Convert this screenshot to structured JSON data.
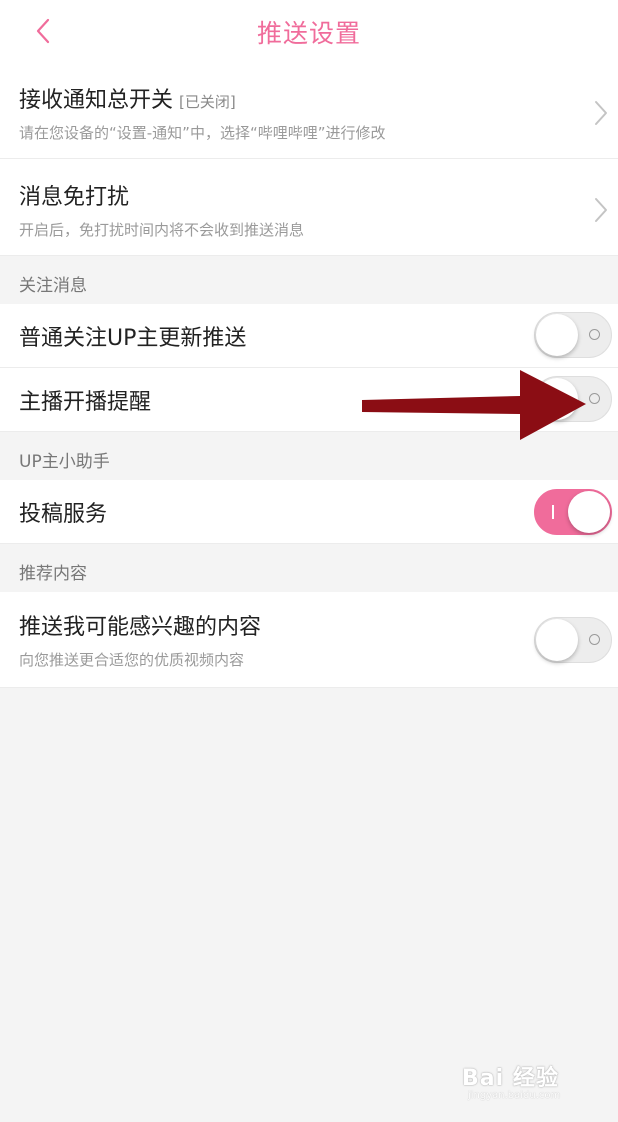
{
  "header": {
    "title": "推送设置"
  },
  "rows": {
    "master": {
      "title": "接收通知总开关",
      "status": "[已关闭]",
      "subtitle": "请在您设备的“设置-通知”中，选择“哔哩哔哩”进行修改"
    },
    "dnd": {
      "title": "消息免打扰",
      "subtitle": "开启后，免打扰时间内将不会收到推送消息"
    },
    "follow_update": {
      "title": "普通关注UP主更新推送",
      "enabled": false
    },
    "live_alert": {
      "title": "主播开播提醒",
      "enabled": false
    },
    "submission": {
      "title": "投稿服务",
      "enabled": true
    },
    "recommend": {
      "title": "推送我可能感兴趣的内容",
      "subtitle": "向您推送更合适您的优质视频内容",
      "enabled": false
    }
  },
  "sections": {
    "follow": "关注消息",
    "up_helper": "UP主小助手",
    "recommend": "推荐内容"
  },
  "colors": {
    "accent": "#f06c9b",
    "arrow": "#8b0d14"
  },
  "watermark": {
    "text": "Bai 经验",
    "sub": "jingyan.baidu.com"
  }
}
